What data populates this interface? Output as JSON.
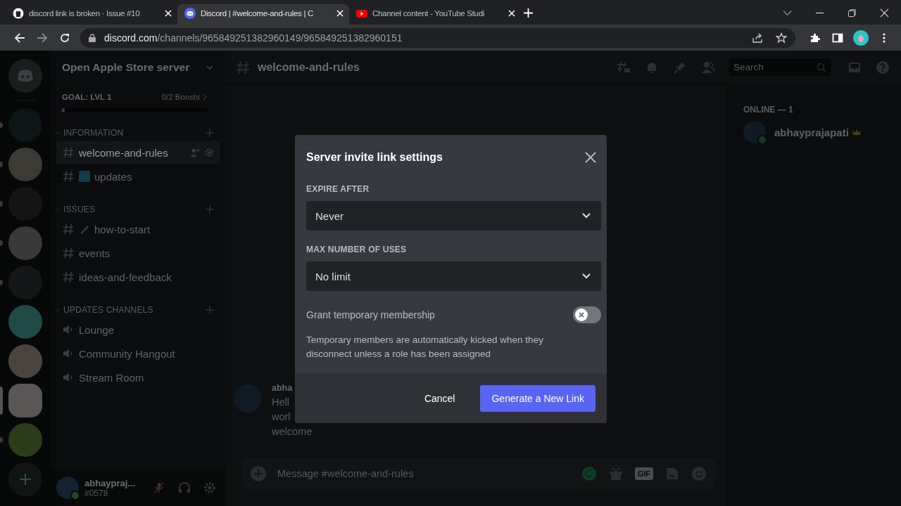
{
  "browser": {
    "tabs": [
      {
        "kind": "github",
        "title": "discord link is broken · Issue #10",
        "selected": false
      },
      {
        "kind": "discord",
        "title": "Discord | #welcome-and-rules | C",
        "selected": true
      },
      {
        "kind": "youtube",
        "title": "Channel content - YouTube Studi",
        "selected": false
      }
    ],
    "url": {
      "domain": "discord.com",
      "path": "/channels/965849251382960149/965849251382960151"
    }
  },
  "servers": [
    {
      "kind": "home",
      "selected": false,
      "unread": false,
      "color": "#1c1d1f"
    },
    {
      "kind": "guild",
      "selected": false,
      "unread": true,
      "color": "#0d1516"
    },
    {
      "kind": "guild",
      "selected": false,
      "unread": true,
      "color": "#3b3a35"
    },
    {
      "kind": "guild",
      "selected": false,
      "unread": true,
      "color": "#141414"
    },
    {
      "kind": "guild",
      "selected": false,
      "unread": true,
      "color": "#3a3939"
    },
    {
      "kind": "guild",
      "selected": false,
      "unread": true,
      "color": "#151617"
    },
    {
      "kind": "guild",
      "selected": false,
      "unread": false,
      "color": "#1f4a46"
    },
    {
      "kind": "guild",
      "selected": false,
      "unread": false,
      "color": "#4a443e"
    },
    {
      "kind": "guild",
      "selected": true,
      "color": "#5b5656"
    },
    {
      "kind": "guild",
      "selected": false,
      "unread": true,
      "color": "#2c3b1a"
    }
  ],
  "server": {
    "name": "Open Apple Store server",
    "goal": "GOAL: LVL 1",
    "boosts": "0/2 Boosts",
    "level": 0
  },
  "categories": [
    {
      "name": "INFORMATION",
      "channels": [
        {
          "kind": "text",
          "name": "welcome-and-rules",
          "selected": true
        },
        {
          "kind": "text",
          "name": "updates",
          "selected": false,
          "emoji": {
            "kind": "new"
          }
        }
      ]
    },
    {
      "name": "ISSUES",
      "channels": [
        {
          "kind": "text",
          "name": "how-to-start",
          "selected": false,
          "emoji": {
            "kind": "pen"
          }
        },
        {
          "kind": "text",
          "name": "events",
          "selected": false
        },
        {
          "kind": "text",
          "name": "ideas-and-feedback",
          "selected": false
        }
      ]
    },
    {
      "name": "UPDATES CHANNELS",
      "channels": [
        {
          "kind": "voice",
          "name": "Lounge",
          "selected": false
        },
        {
          "kind": "voice",
          "name": "Community Hangout",
          "selected": false
        },
        {
          "kind": "voice",
          "name": "Stream Room",
          "selected": false
        }
      ]
    }
  ],
  "user": {
    "name": "abhaypraj...",
    "tag": "#0578"
  },
  "channel_header": {
    "name": "welcome-and-rules",
    "search_placeholder": "Search"
  },
  "message": {
    "author": "abha",
    "lines": [
      "Hell",
      "worl",
      "welcome"
    ]
  },
  "composer": {
    "placeholder": "Message #welcome-and-rules",
    "gif_label": "GIF"
  },
  "members": {
    "heading": "ONLINE — 1",
    "list": [
      {
        "name": "abhayprajapati",
        "owner": true
      }
    ]
  },
  "modal": {
    "title": "Server invite link settings",
    "fields": [
      {
        "label": "EXPIRE AFTER",
        "value": "Never"
      },
      {
        "label": "MAX NUMBER OF USES",
        "value": "No limit"
      }
    ],
    "toggle": {
      "label": "Grant temporary membership",
      "on": false,
      "description": "Temporary members are automatically kicked when they disconnect unless a role has been assigned"
    },
    "cancel": "Cancel",
    "confirm": "Generate a New Link"
  }
}
